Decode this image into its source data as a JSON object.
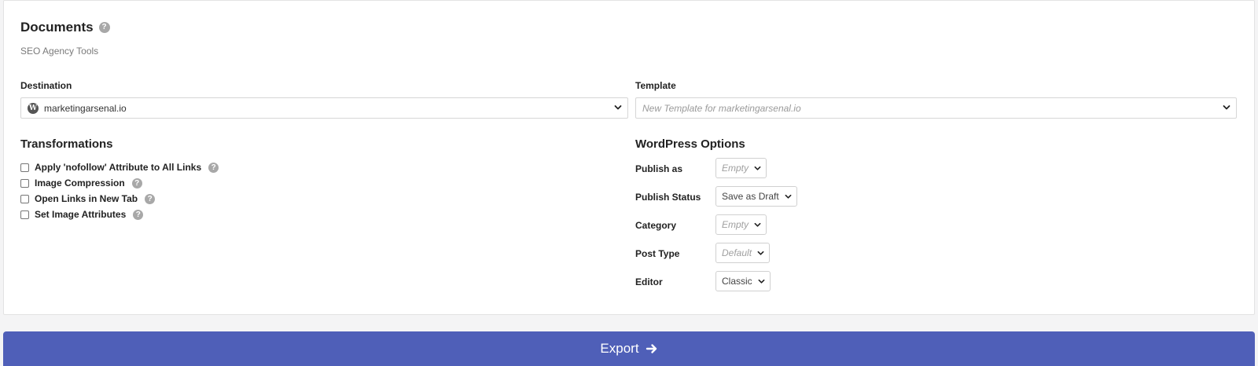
{
  "documents": {
    "title": "Documents",
    "subtitle": "SEO Agency Tools",
    "help_glyph": "?"
  },
  "destination": {
    "label": "Destination",
    "value": "marketingarsenal.io",
    "logo_glyph": "W"
  },
  "template": {
    "label": "Template",
    "placeholder": "New Template for marketingarsenal.io"
  },
  "transformations": {
    "title": "Transformations",
    "items": [
      {
        "label": "Apply 'nofollow' Attribute to All Links",
        "checked": false
      },
      {
        "label": "Image Compression",
        "checked": false
      },
      {
        "label": "Open Links in New Tab",
        "checked": false
      },
      {
        "label": "Set Image Attributes",
        "checked": false
      }
    ]
  },
  "wordpress_options": {
    "title": "WordPress Options",
    "options": [
      {
        "label": "Publish as",
        "value": "Empty",
        "placeholder": true
      },
      {
        "label": "Publish Status",
        "value": "Save as Draft",
        "placeholder": false
      },
      {
        "label": "Category",
        "value": "Empty",
        "placeholder": true
      },
      {
        "label": "Post Type",
        "value": "Default",
        "placeholder": true
      },
      {
        "label": "Editor",
        "value": "Classic",
        "placeholder": false
      }
    ]
  },
  "export": {
    "label": "Export"
  },
  "colors": {
    "accent": "#4f5fb8",
    "help_icon": "#a8a8a8"
  }
}
